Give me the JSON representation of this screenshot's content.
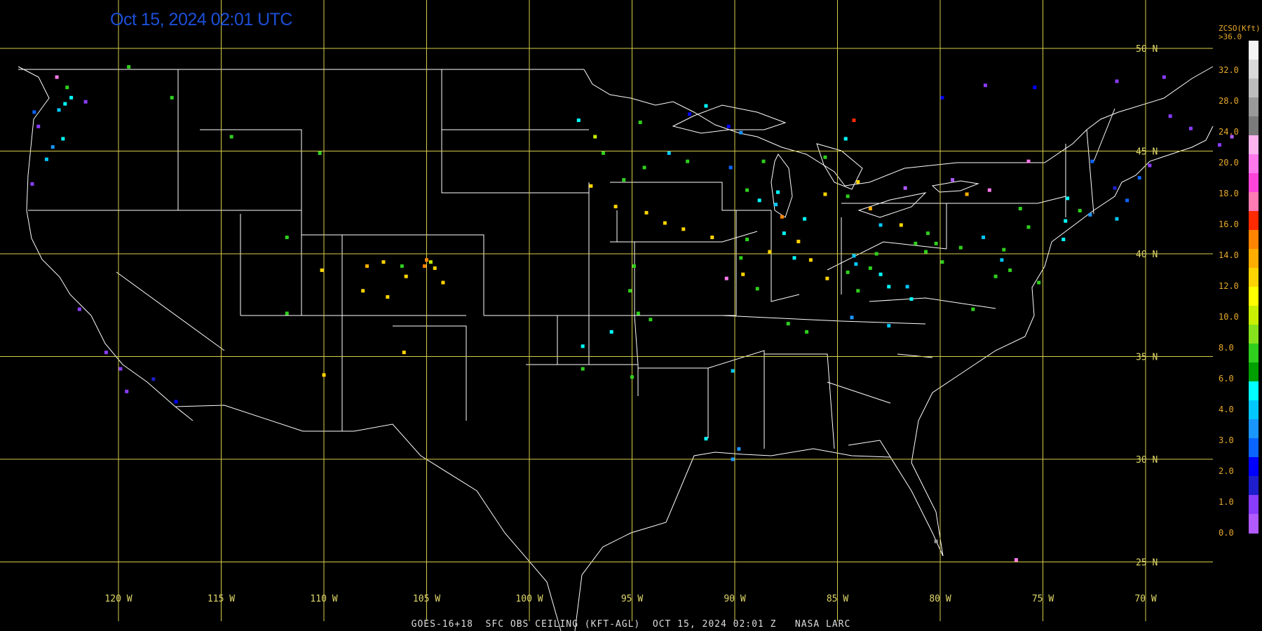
{
  "timestamp": "Oct 15, 2024 02:01 UTC",
  "footer": "GOES-16+18  SFC OBS CEILING (KFT-AGL)  OCT 15, 2024 02:01 Z   NASA LARC",
  "colorbar": {
    "title_line1": "ZCSO(Kft)",
    "title_line2": ">36.0",
    "labels": [
      "32.0",
      "28.0",
      "24.0",
      "20.0",
      "18.0",
      "16.0",
      "14.0",
      "12.0",
      "10.0",
      "8.0",
      "6.0",
      "4.0",
      "3.0",
      "2.0",
      "1.0",
      "0.0"
    ],
    "colors": [
      "#f4f4f4",
      "#d9d9d9",
      "#bdbdbd",
      "#9a9a9a",
      "#7b7b7b",
      "#ffb4f0",
      "#ff79ec",
      "#ff44d9",
      "#ff7bb4",
      "#ff2a00",
      "#ff8400",
      "#ffae00",
      "#ffd400",
      "#ffff00",
      "#c8f000",
      "#86e21c",
      "#2fcf1d",
      "#00a000",
      "#00ffff",
      "#00c8ff",
      "#1a96ff",
      "#0a64ff",
      "#0000ff",
      "#1e1ecc",
      "#8a3cff",
      "#b05aff"
    ]
  },
  "grid": {
    "lat_labels": [
      "50 N",
      "45 N",
      "40 N",
      "35 N",
      "30 N",
      "25 N"
    ],
    "lon_labels": [
      "120 W",
      "115 W",
      "110 W",
      "105 W",
      "100 W",
      "95 W",
      "90 W",
      "85 W",
      "80 W",
      "75 W",
      "70 W"
    ]
  },
  "stations": [
    [
      -122.3,
      47.6,
      "#00ffff"
    ],
    [
      -122.6,
      47.3,
      "#00ffff"
    ],
    [
      -123.0,
      48.6,
      "#ff79ec"
    ],
    [
      -122.9,
      47.0,
      "#00c8ff"
    ],
    [
      -122.5,
      48.1,
      "#2fcf1d"
    ],
    [
      -123.9,
      46.2,
      "#8a3cff"
    ],
    [
      -124.1,
      46.9,
      "#0a64ff"
    ],
    [
      -122.7,
      45.6,
      "#00ffff"
    ],
    [
      -123.2,
      45.2,
      "#1a96ff"
    ],
    [
      -123.5,
      44.6,
      "#00c8ff"
    ],
    [
      -124.2,
      43.4,
      "#8a3cff"
    ],
    [
      -121.6,
      47.4,
      "#8a3cff"
    ],
    [
      -119.5,
      49.1,
      "#2fcf1d"
    ],
    [
      -117.4,
      47.6,
      "#2fcf1d"
    ],
    [
      -121.9,
      37.3,
      "#8a3cff"
    ],
    [
      -120.6,
      35.2,
      "#8a3cff"
    ],
    [
      -118.3,
      33.9,
      "#1e1ecc"
    ],
    [
      -117.2,
      32.8,
      "#0000ff"
    ],
    [
      -119.9,
      34.4,
      "#8a3cff"
    ],
    [
      -119.6,
      33.3,
      "#8a3cff"
    ],
    [
      -114.5,
      45.7,
      "#2fcf1d"
    ],
    [
      -110.2,
      44.9,
      "#2fcf1d"
    ],
    [
      -111.8,
      40.8,
      "#2fcf1d"
    ],
    [
      -110.1,
      39.2,
      "#ffd400"
    ],
    [
      -111.8,
      37.1,
      "#2fcf1d"
    ],
    [
      -107.9,
      39.4,
      "#ffae00"
    ],
    [
      -107.1,
      39.6,
      "#ffd400"
    ],
    [
      -106.2,
      39.4,
      "#2fcf1d"
    ],
    [
      -106.0,
      38.9,
      "#ffd400"
    ],
    [
      -105.1,
      39.4,
      "#ff8400"
    ],
    [
      -105.0,
      39.7,
      "#ff8400"
    ],
    [
      -104.8,
      39.6,
      "#c8f000"
    ],
    [
      -104.6,
      39.3,
      "#ffd400"
    ],
    [
      -104.2,
      38.6,
      "#ffd400"
    ],
    [
      -108.1,
      38.2,
      "#ffd400"
    ],
    [
      -106.9,
      37.9,
      "#ffd400"
    ],
    [
      -110.0,
      34.1,
      "#ffd400"
    ],
    [
      -106.1,
      35.2,
      "#ffd400"
    ],
    [
      -97.6,
      46.5,
      "#00ffff"
    ],
    [
      -96.8,
      45.7,
      "#c8f000"
    ],
    [
      -96.4,
      44.9,
      "#2fcf1d"
    ],
    [
      -97.0,
      43.3,
      "#ffd400"
    ],
    [
      -95.8,
      42.3,
      "#ffd400"
    ],
    [
      -94.3,
      42.0,
      "#ffd400"
    ],
    [
      -93.4,
      41.5,
      "#ffd400"
    ],
    [
      -92.5,
      41.2,
      "#ffd400"
    ],
    [
      -91.1,
      40.8,
      "#ffd400"
    ],
    [
      -95.4,
      43.6,
      "#2fcf1d"
    ],
    [
      -94.4,
      44.2,
      "#2fcf1d"
    ],
    [
      -93.2,
      44.9,
      "#00c8ff"
    ],
    [
      -92.3,
      44.5,
      "#2fcf1d"
    ],
    [
      -94.6,
      46.4,
      "#2fcf1d"
    ],
    [
      -92.2,
      46.8,
      "#0000ff"
    ],
    [
      -91.4,
      47.2,
      "#00ffff"
    ],
    [
      -90.3,
      46.2,
      "#0000ff"
    ],
    [
      -89.7,
      45.9,
      "#1a96ff"
    ],
    [
      -88.6,
      44.5,
      "#2fcf1d"
    ],
    [
      -87.9,
      43.0,
      "#00ffff"
    ],
    [
      -89.4,
      43.1,
      "#2fcf1d"
    ],
    [
      -90.2,
      44.2,
      "#0a64ff"
    ],
    [
      -88.8,
      42.6,
      "#00ffff"
    ],
    [
      -87.7,
      41.8,
      "#ff8400"
    ],
    [
      -89.4,
      40.7,
      "#2fcf1d"
    ],
    [
      -88.3,
      40.1,
      "#ffd400"
    ],
    [
      -89.7,
      39.8,
      "#2fcf1d"
    ],
    [
      -90.4,
      38.8,
      "#ff79ec"
    ],
    [
      -88.9,
      38.3,
      "#2fcf1d"
    ],
    [
      -87.1,
      39.8,
      "#00ffff"
    ],
    [
      -86.3,
      39.7,
      "#ffd400"
    ],
    [
      -85.5,
      38.8,
      "#ffd400"
    ],
    [
      -86.6,
      41.7,
      "#00ffff"
    ],
    [
      -85.6,
      42.9,
      "#ffd400"
    ],
    [
      -84.5,
      42.8,
      "#2fcf1d"
    ],
    [
      -83.4,
      42.2,
      "#ffae00"
    ],
    [
      -84.6,
      45.6,
      "#00ffff"
    ],
    [
      -85.6,
      44.7,
      "#2fcf1d"
    ],
    [
      -84.0,
      43.5,
      "#ffd400"
    ],
    [
      -84.2,
      46.5,
      "#ff2a00"
    ],
    [
      -83.1,
      40.0,
      "#2fcf1d"
    ],
    [
      -82.9,
      41.4,
      "#00c8ff"
    ],
    [
      -81.9,
      41.4,
      "#ffd400"
    ],
    [
      -84.2,
      39.9,
      "#00c8ff"
    ],
    [
      -84.5,
      39.1,
      "#2fcf1d"
    ],
    [
      -84.0,
      38.2,
      "#2fcf1d"
    ],
    [
      -82.5,
      38.4,
      "#00ffff"
    ],
    [
      -81.6,
      38.4,
      "#00c8ff"
    ],
    [
      -80.2,
      40.5,
      "#2fcf1d"
    ],
    [
      -79.9,
      39.6,
      "#2fcf1d"
    ],
    [
      -79.0,
      40.3,
      "#2fcf1d"
    ],
    [
      -77.9,
      40.8,
      "#00c8ff"
    ],
    [
      -77.0,
      39.7,
      "#00c8ff"
    ],
    [
      -76.9,
      40.2,
      "#2fcf1d"
    ],
    [
      -75.7,
      41.3,
      "#2fcf1d"
    ],
    [
      -76.1,
      42.2,
      "#2fcf1d"
    ],
    [
      -77.6,
      43.1,
      "#ff79ec"
    ],
    [
      -78.7,
      42.9,
      "#ffae00"
    ],
    [
      -79.4,
      43.6,
      "#b05aff"
    ],
    [
      -80.6,
      41.0,
      "#2fcf1d"
    ],
    [
      -81.4,
      37.8,
      "#00ffff"
    ],
    [
      -82.5,
      36.5,
      "#00c8ff"
    ],
    [
      -84.3,
      36.9,
      "#1a96ff"
    ],
    [
      -86.5,
      36.2,
      "#2fcf1d"
    ],
    [
      -87.4,
      36.6,
      "#2fcf1d"
    ],
    [
      -78.4,
      37.3,
      "#2fcf1d"
    ],
    [
      -77.3,
      38.9,
      "#2fcf1d"
    ],
    [
      -76.6,
      39.2,
      "#2fcf1d"
    ],
    [
      -75.2,
      38.6,
      "#2fcf1d"
    ],
    [
      -74.0,
      40.7,
      "#00ffff"
    ],
    [
      -73.9,
      41.6,
      "#00ffff"
    ],
    [
      -73.2,
      42.1,
      "#2fcf1d"
    ],
    [
      -72.6,
      44.5,
      "#0a64ff"
    ],
    [
      -71.5,
      43.2,
      "#1e1ecc"
    ],
    [
      -70.3,
      43.7,
      "#0a64ff"
    ],
    [
      -69.8,
      44.3,
      "#8a3cff"
    ],
    [
      -68.8,
      46.7,
      "#8a3cff"
    ],
    [
      -67.8,
      46.1,
      "#8a3cff"
    ],
    [
      -70.9,
      42.6,
      "#0a64ff"
    ],
    [
      -71.4,
      41.7,
      "#00c8ff"
    ],
    [
      -72.7,
      41.9,
      "#1a96ff"
    ],
    [
      -73.8,
      42.7,
      "#00ffff"
    ],
    [
      -75.7,
      44.5,
      "#ff79ec"
    ],
    [
      -79.9,
      47.6,
      "#0000ff"
    ],
    [
      -77.8,
      48.2,
      "#8a3cff"
    ],
    [
      -75.4,
      48.1,
      "#0000ff"
    ],
    [
      -71.4,
      48.4,
      "#8a3cff"
    ],
    [
      -69.1,
      48.6,
      "#8a3cff"
    ],
    [
      -66.4,
      45.3,
      "#8a3cff"
    ],
    [
      -65.8,
      45.7,
      "#b05aff"
    ],
    [
      -94.9,
      39.4,
      "#2fcf1d"
    ],
    [
      -95.1,
      38.2,
      "#2fcf1d"
    ],
    [
      -94.7,
      37.1,
      "#2fcf1d"
    ],
    [
      -94.1,
      36.8,
      "#2fcf1d"
    ],
    [
      -96.0,
      36.2,
      "#00ffff"
    ],
    [
      -97.4,
      35.5,
      "#00ffff"
    ],
    [
      -97.4,
      34.4,
      "#2fcf1d"
    ],
    [
      -95.0,
      34.0,
      "#2fcf1d"
    ],
    [
      -90.1,
      34.3,
      "#00c8ff"
    ],
    [
      -91.4,
      31.0,
      "#00ffff"
    ],
    [
      -89.8,
      30.5,
      "#1a96ff"
    ],
    [
      -90.1,
      30.0,
      "#1a96ff"
    ],
    [
      -89.6,
      39.0,
      "#ffd400"
    ],
    [
      -86.9,
      40.6,
      "#ffd400"
    ],
    [
      -87.6,
      41.0,
      "#00ffff"
    ],
    [
      -88.0,
      42.4,
      "#00c8ff"
    ],
    [
      -84.1,
      39.5,
      "#00c8ff"
    ],
    [
      -83.4,
      39.3,
      "#2fcf1d"
    ],
    [
      -82.9,
      39.0,
      "#00ffff"
    ],
    [
      -81.2,
      40.5,
      "#2fcf1d"
    ],
    [
      -80.7,
      40.1,
      "#2fcf1d"
    ],
    [
      -81.7,
      43.2,
      "#b05aff"
    ],
    [
      -76.3,
      25.1,
      "#ff79ec"
    ],
    [
      -80.2,
      26.0,
      "#9a9a9a"
    ]
  ]
}
